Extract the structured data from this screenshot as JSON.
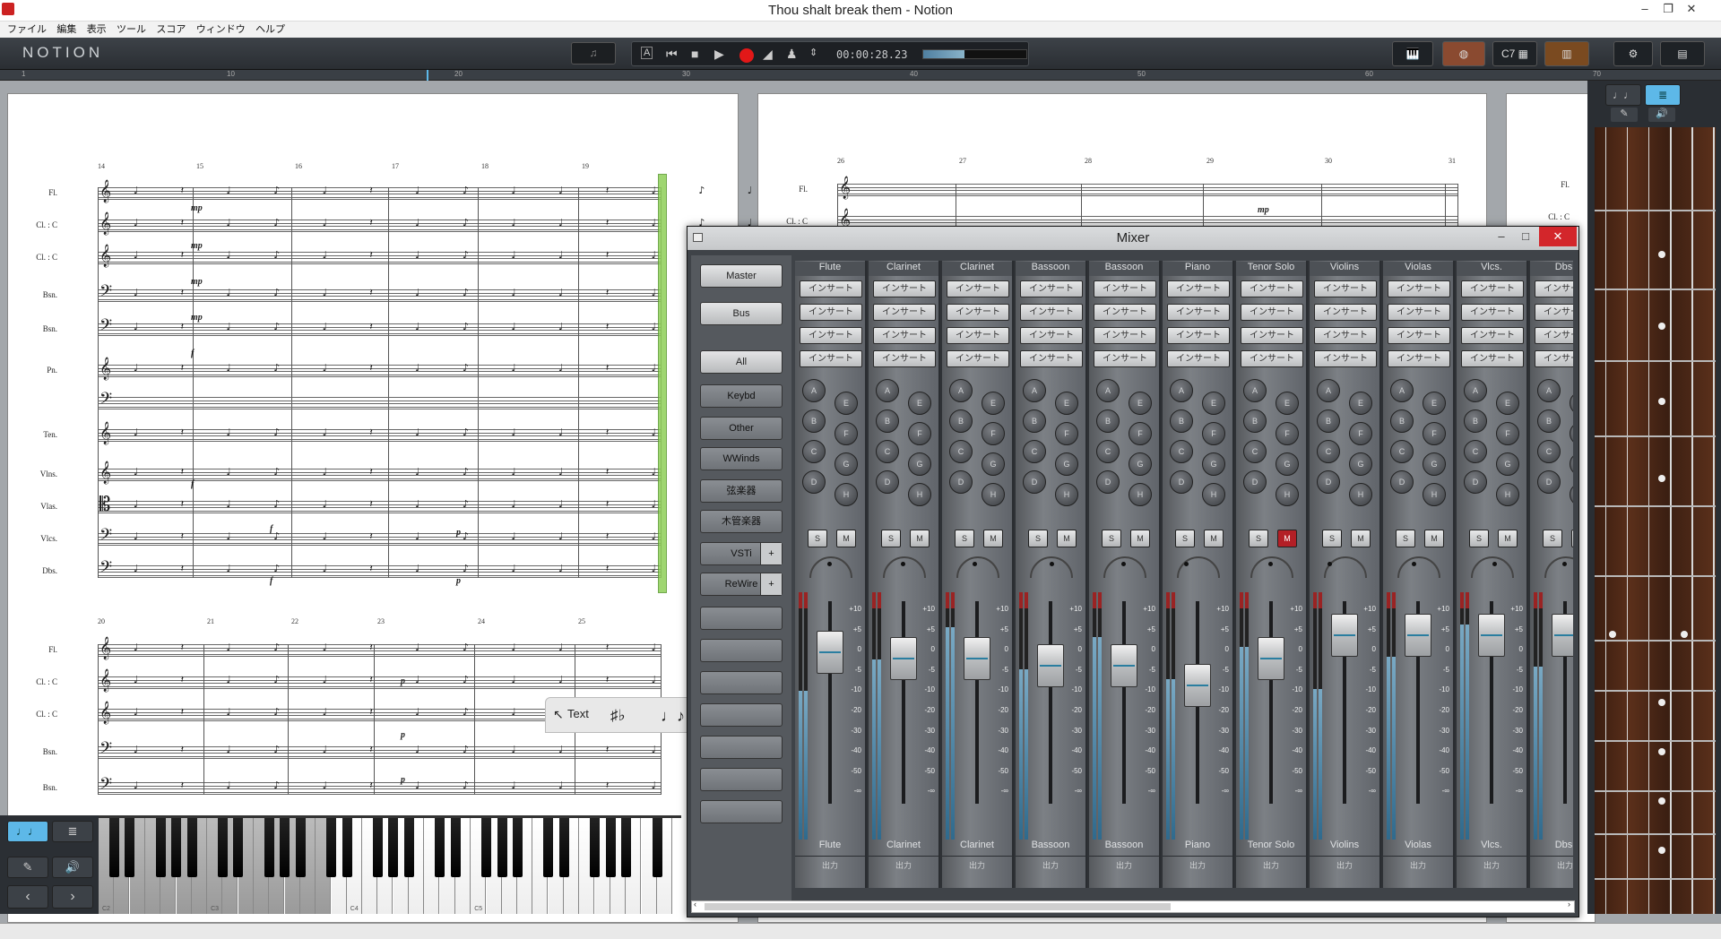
{
  "window": {
    "title": "Thou shalt break them - Notion"
  },
  "menu": [
    "ファイル",
    "編集",
    "表示",
    "ツール",
    "スコア",
    "ウィンドウ",
    "ヘルプ"
  ],
  "toolbar": {
    "logo": "NOTION",
    "time": "00:00:28.23",
    "c7_label": "C7",
    "transport_level": 0.4
  },
  "ruler": [
    "1",
    "10",
    "20",
    "30",
    "40",
    "50",
    "60",
    "70"
  ],
  "score": {
    "page1_system1": {
      "bars": [
        "14",
        "15",
        "16",
        "17",
        "18",
        "19"
      ],
      "instruments": [
        "Fl.",
        "Cl. : C",
        "Cl. : C",
        "Bsn.",
        "Bsn.",
        "Pn.",
        "Ten.",
        "Vlns.",
        "Vlas.",
        "Vlcs.",
        "Dbs."
      ]
    },
    "page1_system2": {
      "bars": [
        "20",
        "21",
        "22",
        "23",
        "24",
        "25"
      ],
      "instruments": [
        "Fl.",
        "Cl. : C",
        "Cl. : C",
        "Bsn.",
        "Bsn."
      ]
    },
    "page2": {
      "bars": [
        "26",
        "27",
        "28",
        "29",
        "30",
        "31"
      ],
      "instruments": [
        "Fl.",
        "Cl. : C"
      ]
    },
    "page3": {
      "instruments": [
        "Fl.",
        "Cl. : C"
      ]
    },
    "dynamics": [
      "mp",
      "mp",
      "mp",
      "mp",
      "f",
      "f",
      "f",
      "f",
      "p",
      "p",
      "p",
      "p",
      "p",
      "p",
      "p",
      "mp"
    ]
  },
  "palette": {
    "text_label": "Text",
    "accidental_label": "♯♭"
  },
  "keyboard": {
    "labels": [
      "C2",
      "C3",
      "C4",
      "C5"
    ]
  },
  "mixer": {
    "title": "Mixer",
    "side_buttons": [
      "Master",
      "Bus",
      "All",
      "Keybd",
      "Other",
      "WWinds",
      "弦楽器",
      "木管楽器",
      "VSTi",
      "ReWire"
    ],
    "insert_label": "インサート",
    "send_labels": [
      "A",
      "B",
      "C",
      "D",
      "E",
      "F",
      "G",
      "H"
    ],
    "solo_label": "S",
    "mute_label": "M",
    "output_label": "出力",
    "scale": [
      "+10",
      "+5",
      "0",
      "-5",
      "-10",
      "-20",
      "-30",
      "-40",
      "-50",
      "-∞"
    ],
    "channels": [
      {
        "name": "Flute",
        "fader_db": -5,
        "mute": false
      },
      {
        "name": "Clarinet",
        "fader_db": -7,
        "mute": false
      },
      {
        "name": "Clarinet",
        "fader_db": -7,
        "mute": false
      },
      {
        "name": "Bassoon",
        "fader_db": -9,
        "mute": false
      },
      {
        "name": "Bassoon",
        "fader_db": -9,
        "mute": false
      },
      {
        "name": "Piano",
        "fader_db": -15,
        "mute": false
      },
      {
        "name": "Tenor Solo",
        "fader_db": -7,
        "mute": true
      },
      {
        "name": "Violins",
        "fader_db": 0,
        "mute": false
      },
      {
        "name": "Violas",
        "fader_db": 0,
        "mute": false
      },
      {
        "name": "Vlcs.",
        "fader_db": 0,
        "mute": false
      },
      {
        "name": "Dbs.",
        "fader_db": 0,
        "mute": false
      }
    ]
  }
}
